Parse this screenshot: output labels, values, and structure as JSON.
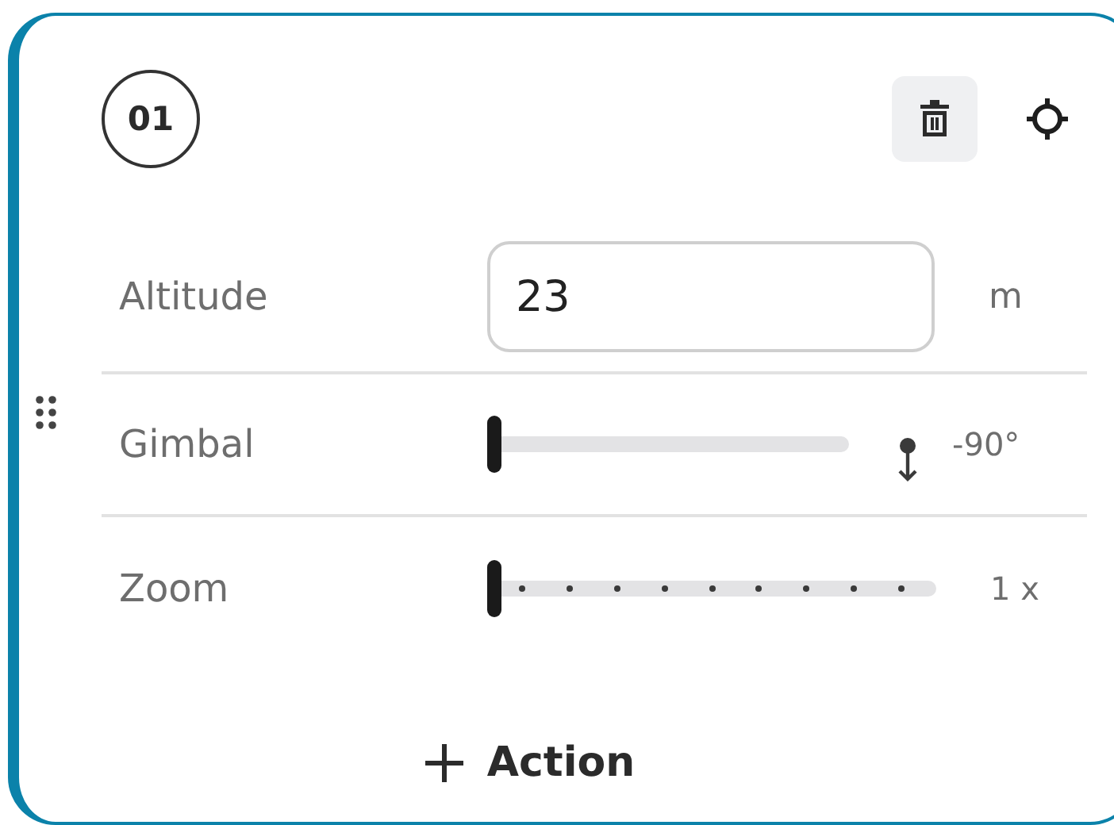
{
  "waypoint": {
    "number": "01"
  },
  "rows": [
    {
      "kind": "input",
      "label": "Altitude",
      "value": "23",
      "unit": "m"
    },
    {
      "kind": "slider",
      "label": "Gimbal",
      "level": 0,
      "reading": "-90°"
    },
    {
      "kind": "stepped",
      "label": "Zoom",
      "level": 0,
      "reading": "1 x"
    }
  ],
  "add_button": {
    "label": "Action"
  }
}
